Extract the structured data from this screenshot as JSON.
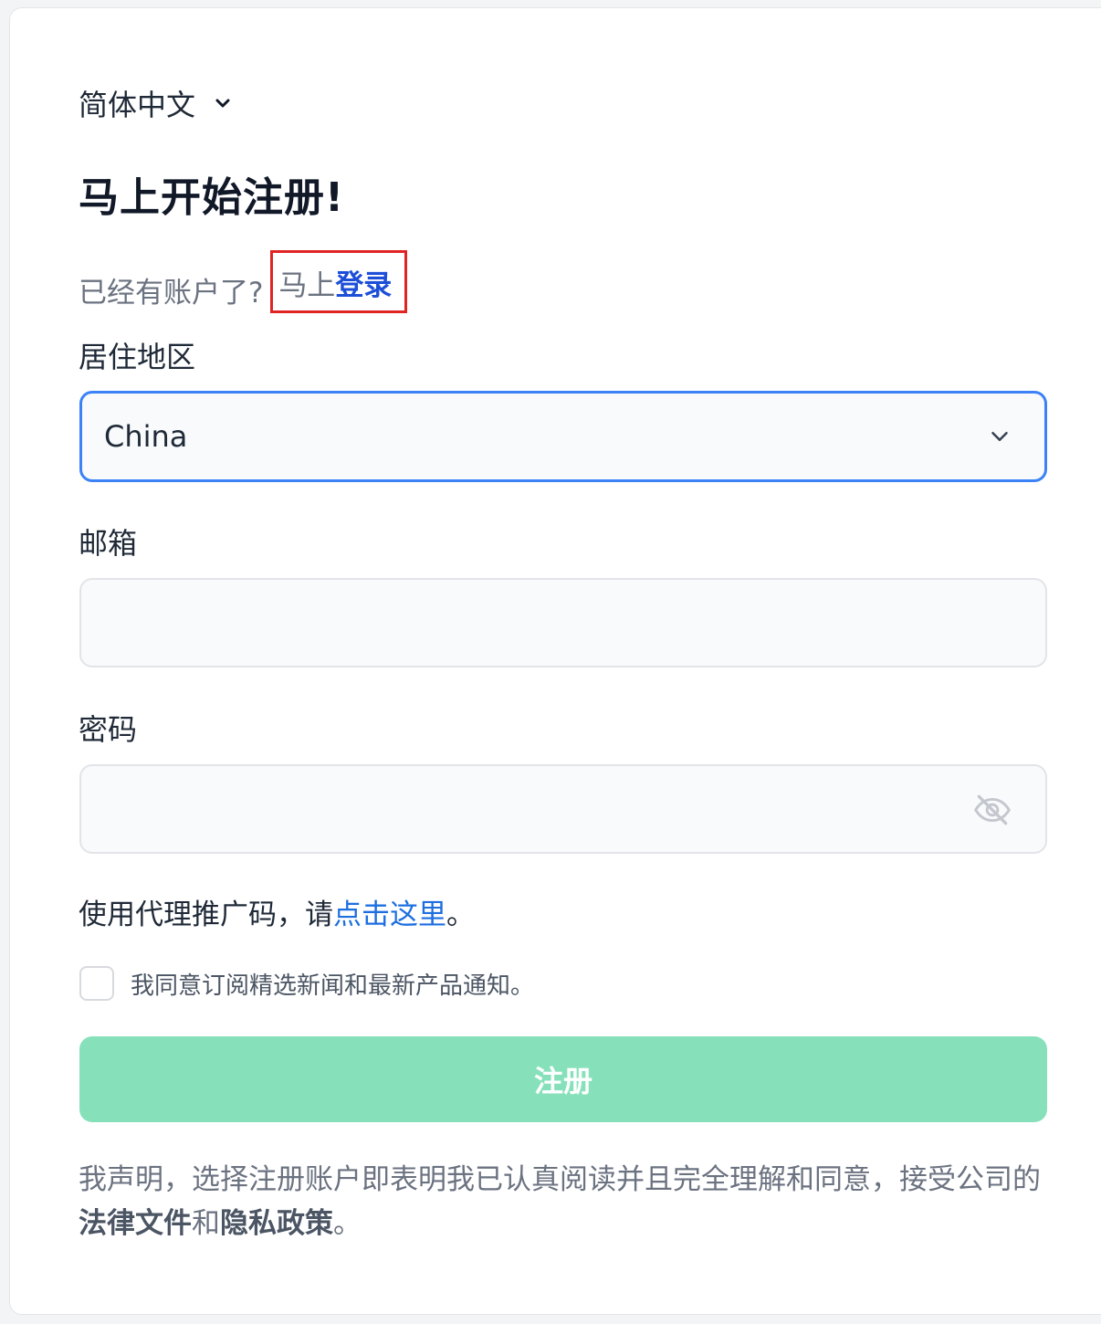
{
  "language": {
    "label": "简体中文"
  },
  "page_title": "马上开始注册!",
  "login_prompt": {
    "text": "已经有账户了?",
    "pre": "马上",
    "link": "登录"
  },
  "region": {
    "label": "居住地区",
    "value": "China"
  },
  "email": {
    "label": "邮箱",
    "value": ""
  },
  "password": {
    "label": "密码",
    "value": ""
  },
  "promo": {
    "text": "使用代理推广码，请",
    "link": "点击这里",
    "end": "。"
  },
  "subscribe": {
    "label": "我同意订阅精选新闻和最新产品通知。",
    "checked": false
  },
  "submit_label": "注册",
  "legal": {
    "text": "我声明，选择注册账户即表明我已认真阅读并且完全理解和同意，接受公司的",
    "legal_docs": "法律文件",
    "and": "和",
    "privacy": "隐私政策",
    "end": "。"
  },
  "colors": {
    "accent": "#1d4ed8",
    "submit_bg": "#86e1bb",
    "highlight_box": "#e02424",
    "focus_border": "#3b82f6"
  }
}
